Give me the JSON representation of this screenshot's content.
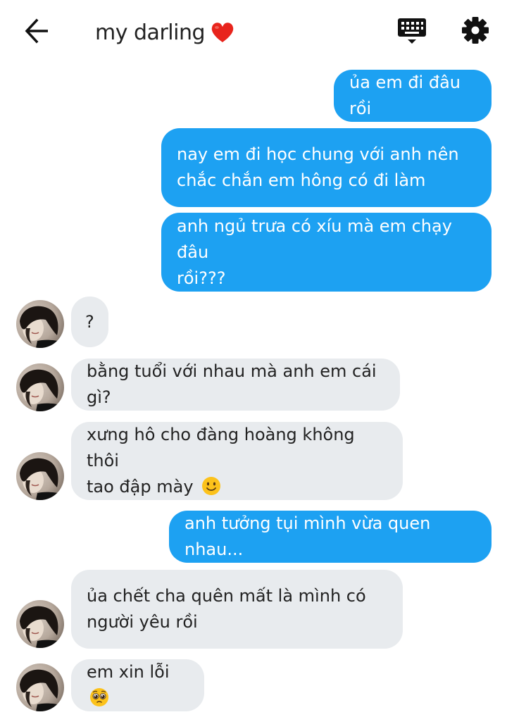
{
  "header": {
    "title": "my darling",
    "title_emoji": "red-heart-icon",
    "icons": [
      "arrow-left-icon",
      "keyboard-icon",
      "gear-icon"
    ]
  },
  "messages": [
    {
      "side": "sent",
      "text": "ủa em đi đâu rồi"
    },
    {
      "side": "sent",
      "lines": [
        "nay em đi học chung với anh nên",
        "chắc chắn em hông có đi làm"
      ]
    },
    {
      "side": "sent",
      "lines": [
        "anh ngủ trưa có xíu mà em chạy đâu",
        "rồi???"
      ]
    },
    {
      "side": "received",
      "text": "?"
    },
    {
      "side": "received",
      "text": "bằng tuổi với nhau mà anh em cái gì?"
    },
    {
      "side": "received",
      "lines": [
        "xưng hô cho đàng hoàng không thôi",
        "tao đập mày"
      ],
      "emoji": "slightly-smiling-face-icon"
    },
    {
      "side": "sent",
      "text": "anh tưởng tụi mình vừa quen nhau..."
    },
    {
      "side": "received",
      "lines": [
        "ủa chết cha quên mất là mình có",
        "người yêu rồi"
      ]
    },
    {
      "side": "received",
      "text": "em xin lỗi",
      "emoji": "pleading-face-icon"
    }
  ],
  "colors": {
    "sent_bubble": "#1da1f2",
    "received_bubble": "#e8ebee",
    "sent_text": "#ffffff",
    "received_text": "#222222"
  }
}
